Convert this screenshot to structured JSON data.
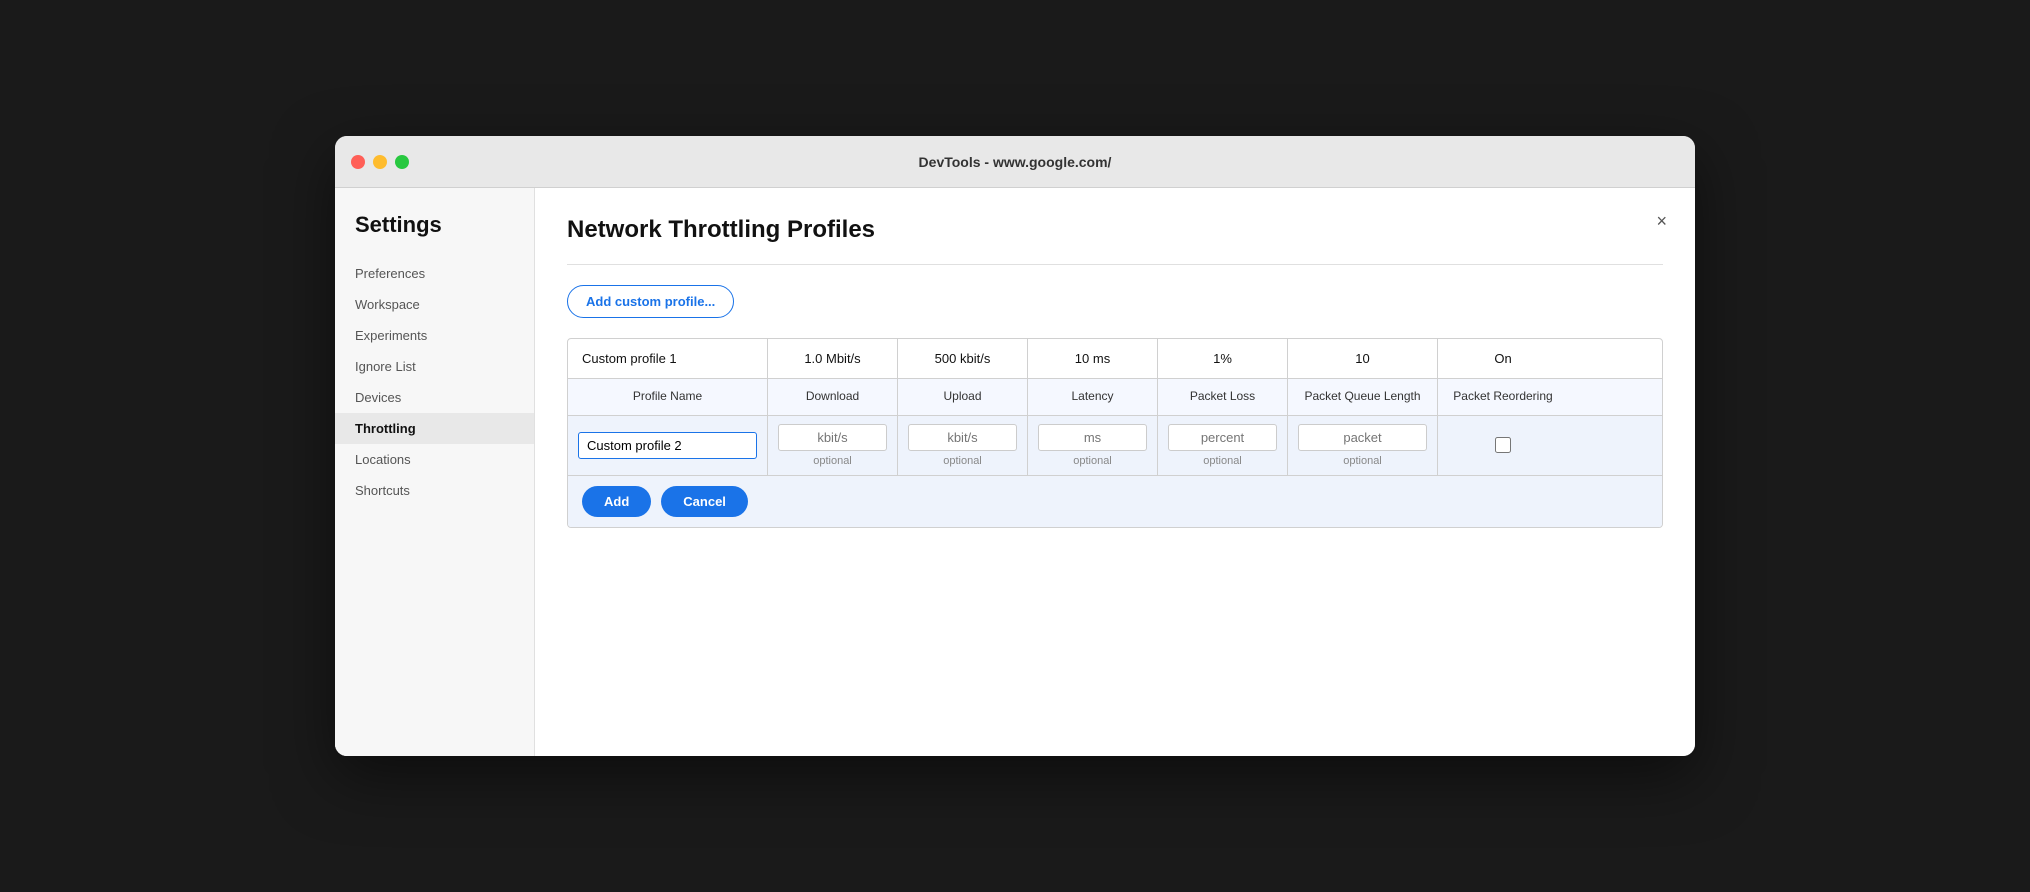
{
  "titlebar": {
    "title": "DevTools - www.google.com/"
  },
  "sidebar": {
    "heading": "Settings",
    "items": [
      {
        "id": "preferences",
        "label": "Preferences",
        "active": false
      },
      {
        "id": "workspace",
        "label": "Workspace",
        "active": false
      },
      {
        "id": "experiments",
        "label": "Experiments",
        "active": false
      },
      {
        "id": "ignore-list",
        "label": "Ignore List",
        "active": false
      },
      {
        "id": "devices",
        "label": "Devices",
        "active": false
      },
      {
        "id": "throttling",
        "label": "Throttling",
        "active": true
      },
      {
        "id": "locations",
        "label": "Locations",
        "active": false
      },
      {
        "id": "shortcuts",
        "label": "Shortcuts",
        "active": false
      }
    ]
  },
  "main": {
    "title": "Network Throttling Profiles",
    "add_button_label": "Add custom profile...",
    "close_label": "×",
    "table": {
      "existing_row": {
        "name": "Custom profile 1",
        "download": "1.0 Mbit/s",
        "upload": "500 kbit/s",
        "latency": "10 ms",
        "packet_loss": "1%",
        "packet_queue": "10",
        "packet_reordering": "On"
      },
      "headers": {
        "name": "Profile Name",
        "download": "Download",
        "upload": "Upload",
        "latency": "Latency",
        "packet_loss": "Packet Loss",
        "packet_queue": "Packet Queue Length",
        "packet_reordering": "Packet Reordering"
      },
      "new_row": {
        "name_value": "Custom profile 2",
        "name_placeholder": "",
        "download_placeholder": "kbit/s",
        "upload_placeholder": "kbit/s",
        "latency_placeholder": "ms",
        "packet_loss_placeholder": "percent",
        "packet_queue_placeholder": "packet",
        "optional_hint": "optional"
      }
    },
    "add_label": "Add",
    "cancel_label": "Cancel"
  }
}
